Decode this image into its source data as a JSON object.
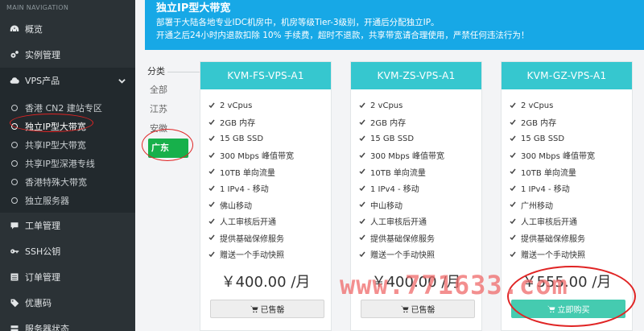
{
  "sidebar": {
    "heading": "MAIN NAVIGATION",
    "items": [
      {
        "label": "概览",
        "icon": "dashboard-icon"
      },
      {
        "label": "实例管理",
        "icon": "gears-icon"
      },
      {
        "label": "VPS产品",
        "icon": "cloud-icon"
      },
      {
        "label": "工单管理",
        "icon": "comment-icon"
      },
      {
        "label": "SSH公钥",
        "icon": "key-icon"
      },
      {
        "label": "订单管理",
        "icon": "list-icon"
      },
      {
        "label": "优惠码",
        "icon": "tag-icon"
      },
      {
        "label": "服务器状态",
        "icon": "server-icon"
      }
    ],
    "sub_items": [
      {
        "label": "香港 CN2 建站专区"
      },
      {
        "label": "独立IP型大带宽"
      },
      {
        "label": "共享IP型大带宽"
      },
      {
        "label": "共享IP型深港专线"
      },
      {
        "label": "香港特殊大带宽"
      },
      {
        "label": "独立服务器"
      }
    ]
  },
  "notice": {
    "title": "独立IP型大带宽",
    "line1": "部署于大陆各地专业IDC机房中，机房等级Tier-3级别，开通后分配独立IP。",
    "line2": "开通之后24小时内退款扣除 10% 手续费，超时不退款，共享带宽请合理使用，严禁任何违法行为！"
  },
  "filter": {
    "label": "分类",
    "options": [
      "全部",
      "江苏",
      "安徽",
      "广东"
    ],
    "selected": "广东"
  },
  "cards": [
    {
      "name": "KVM-FS-VPS-A1",
      "features": [
        "2 vCpus",
        "2GB 内存",
        "15 GB SSD",
        "300 Mbps 峰值带宽",
        "10TB 单向流量",
        "1 IPv4 - 移动",
        "佛山移动",
        "人工审核后开通",
        "提供基础保修服务",
        "赠送一个手动快照"
      ],
      "price": "￥400.00 /月",
      "button": "已售罄",
      "status_color": "#eeeeee"
    },
    {
      "name": "KVM-ZS-VPS-A1",
      "features": [
        "2 vCpus",
        "2GB 内存",
        "15 GB SSD",
        "300 Mbps 峰值带宽",
        "10TB 单向流量",
        "1 IPv4 - 移动",
        "中山移动",
        "人工审核后开通",
        "提供基础保修服务",
        "赠送一个手动快照"
      ],
      "price": "￥400.00 /月",
      "button": "已售罄",
      "status_color": "#eeeeee"
    },
    {
      "name": "KVM-GZ-VPS-A1",
      "features": [
        "2 vCpus",
        "2GB 内存",
        "15 GB SSD",
        "300 Mbps 峰值带宽",
        "10TB 单向流量",
        "1 IPv4 - 移动",
        "广州移动",
        "人工审核后开通",
        "提供基础保修服务",
        "赠送一个手动快照"
      ],
      "price": "￥555.00 /月",
      "button": "立即购买",
      "status_color": "#45cbb0"
    }
  ],
  "watermark": "www.771633.com",
  "colors": {
    "sidebar_bg": "#2b3236",
    "notice_bg": "#17a8e6",
    "card_header": "#36c7cf",
    "filter_selected": "#17b04b",
    "buy_green": "#45cbb0",
    "annotation_red": "#e02424"
  }
}
